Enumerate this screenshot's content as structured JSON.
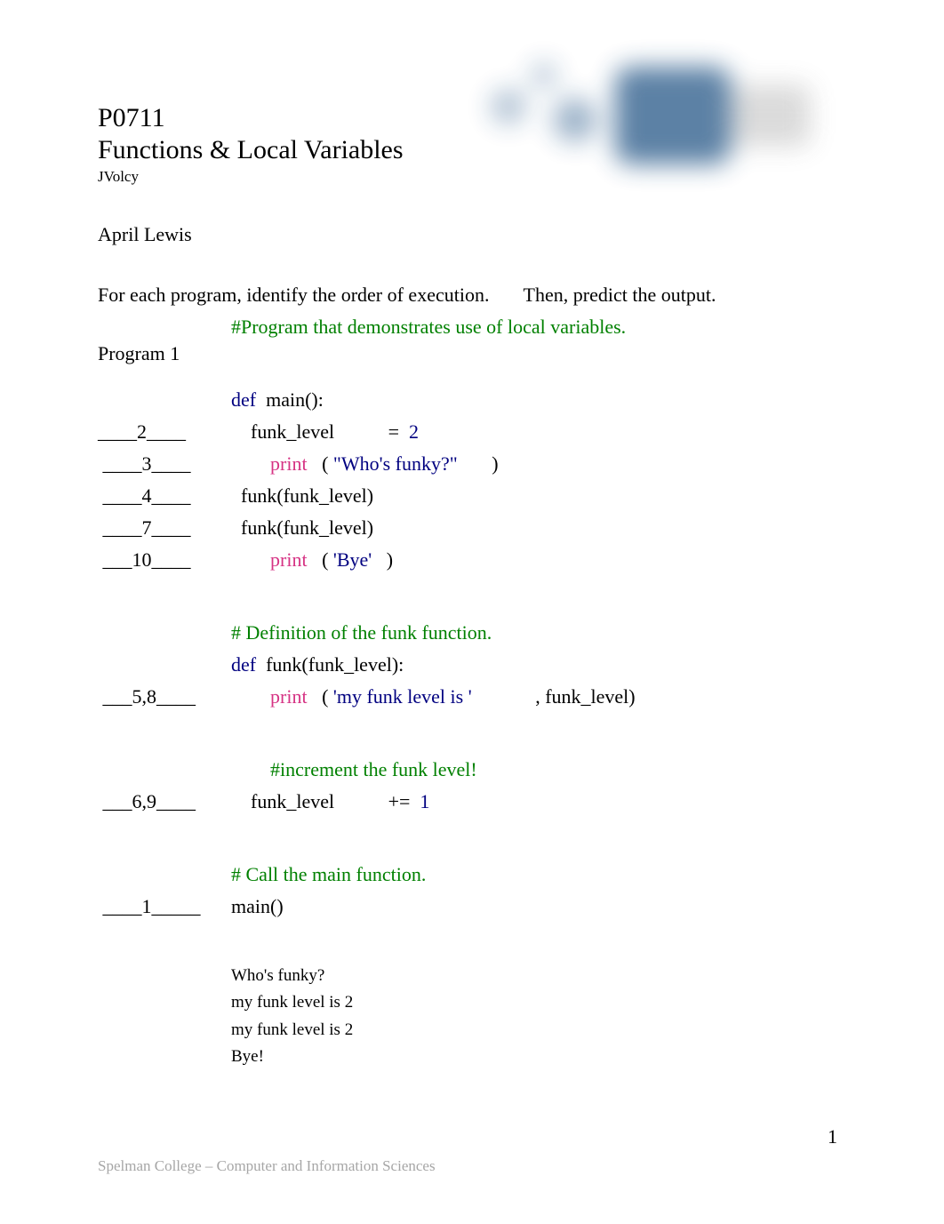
{
  "header": {
    "course_code": "P0711",
    "title": "Functions & Local Variables",
    "author": "JVolcy"
  },
  "student_name": "April Lewis",
  "instructions": "For each program, identify the order of execution.       Then, predict the output.",
  "program_label": "Program 1",
  "orders": {
    "r1": "____2____",
    "r2": " ____3____",
    "r3": " ____4____",
    "r4": " ____7____",
    "r5": " ___10____",
    "r6": " ___5,8____",
    "r7": " ___6,9____",
    "r8": " ____1_____"
  },
  "code": {
    "comment_top": "#Program that demonstrates use of local variables.",
    "def_kw": "def",
    "main_sig": " main():",
    "funk_level_assign_pre": "    funk_level           ",
    "eq": "=",
    "space_num2": "  2",
    "print_kw": "print",
    "who_string": "\"Who's funky?\"",
    "who_close": "       )",
    "funk_call": "  funk(funk_level)",
    "bye_string": "'Bye'",
    "bye_close": "   )",
    "comment_funk_def": "# Definition of the funk function.",
    "funk_sig": " funk(funk_level):",
    "myfunk_string": "'my funk level is '",
    "myfunk_tail": "             , funk_level)",
    "comment_inc": "#increment the funk level!",
    "inc_pre": "    funk_level           ",
    "pluseq": "+=",
    "space_num1": "  1",
    "comment_call": "# Call the main function.",
    "main_call": "main()",
    "indent_print_open": "        ",
    "open_paren_sp": "   ( "
  },
  "output": {
    "l1": "Who's funky?",
    "l2": "my funk level is 2",
    "l3": "my funk level is 2",
    "l4": "Bye!"
  },
  "footer": "Spelman College – Computer and Information Sciences",
  "page_number": "1"
}
